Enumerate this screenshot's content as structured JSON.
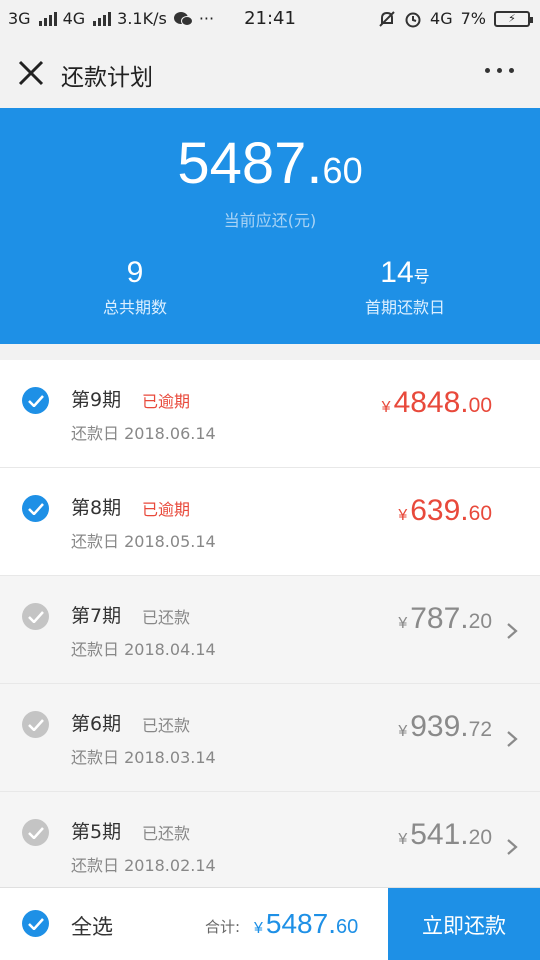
{
  "status_bar": {
    "network1": "3G",
    "network2": "4G",
    "speed": "3.1K/s",
    "more": "···",
    "time": "21:41",
    "net_right": "4G",
    "battery_pct": "7%"
  },
  "nav": {
    "title": "还款计划"
  },
  "summary": {
    "amount_int": "5487.",
    "amount_dec": "60",
    "amount_label": "当前应还(元)",
    "periods_value": "9",
    "periods_label": "总共期数",
    "first_day_value": "14",
    "first_day_unit": "号",
    "first_day_label": "首期还款日"
  },
  "installments": [
    {
      "period": "第9期",
      "status": "已逾期",
      "date": "还款日 2018.06.14",
      "yen": "¥",
      "int": "4848.",
      "dec": "00",
      "state": "overdue"
    },
    {
      "period": "第8期",
      "status": "已逾期",
      "date": "还款日 2018.05.14",
      "yen": "¥",
      "int": "639.",
      "dec": "60",
      "state": "overdue"
    },
    {
      "period": "第7期",
      "status": "已还款",
      "date": "还款日 2018.04.14",
      "yen": "¥",
      "int": "787.",
      "dec": "20",
      "state": "paid"
    },
    {
      "period": "第6期",
      "status": "已还款",
      "date": "还款日 2018.03.14",
      "yen": "¥",
      "int": "939.",
      "dec": "72",
      "state": "paid"
    },
    {
      "period": "第5期",
      "status": "已还款",
      "date": "还款日 2018.02.14",
      "yen": "¥",
      "int": "541.",
      "dec": "20",
      "state": "paid"
    }
  ],
  "footer": {
    "select_all": "全选",
    "total_label": "合计:",
    "yen": "¥",
    "total_int": "5487.",
    "total_dec": "60",
    "pay_button": "立即还款"
  },
  "colors": {
    "brand": "#1e90e6",
    "overdue": "#e8493b",
    "paid": "#8a8a8a"
  },
  "icons": [
    "close-icon",
    "more-icon",
    "check-icon",
    "chevron-right-icon",
    "signal-icon",
    "wechat-icon",
    "mute-icon",
    "alarm-icon",
    "battery-icon"
  ]
}
